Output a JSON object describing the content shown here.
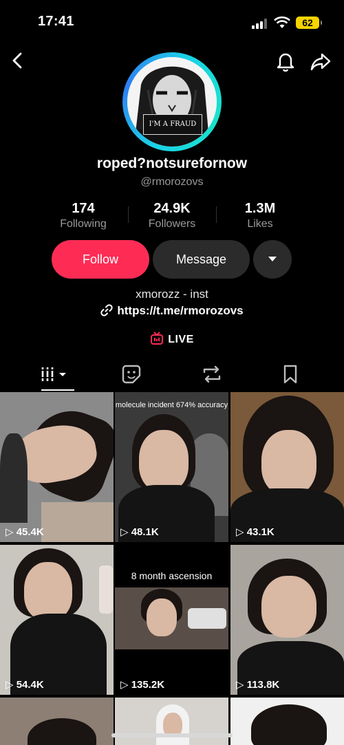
{
  "status": {
    "time": "17:41",
    "battery": "62"
  },
  "profile": {
    "avatar_sign": "I'M A FRAUD",
    "display_name": "roped?notsurefornow",
    "username": "@rmorozovs",
    "stats": [
      {
        "value": "174",
        "label": "Following"
      },
      {
        "value": "24.9K",
        "label": "Followers"
      },
      {
        "value": "1.3M",
        "label": "Likes"
      }
    ],
    "buttons": {
      "follow": "Follow",
      "message": "Message"
    },
    "bio": "xmorozz - inst",
    "link": "https://t.me/rmorozovs",
    "live_label": "LIVE"
  },
  "tabs": [
    {
      "icon": "grid-icon",
      "active": true
    },
    {
      "icon": "sticker-icon"
    },
    {
      "icon": "repost-icon"
    },
    {
      "icon": "bookmark-icon"
    }
  ],
  "videos": [
    {
      "views": "45.4K",
      "caption": ""
    },
    {
      "views": "48.1K",
      "caption": "molecule incident 674% accuracy"
    },
    {
      "views": "43.1K",
      "caption": ""
    },
    {
      "views": "54.4K",
      "caption": ""
    },
    {
      "views": "135.2K",
      "caption": "8 month ascension"
    },
    {
      "views": "113.8K",
      "caption": ""
    }
  ],
  "colors": {
    "follow": "#fe2c55",
    "live": "#fe2c55",
    "ring_start": "#1ad3e6",
    "ring_end": "#2f7df3",
    "battery": "#f5d400"
  }
}
